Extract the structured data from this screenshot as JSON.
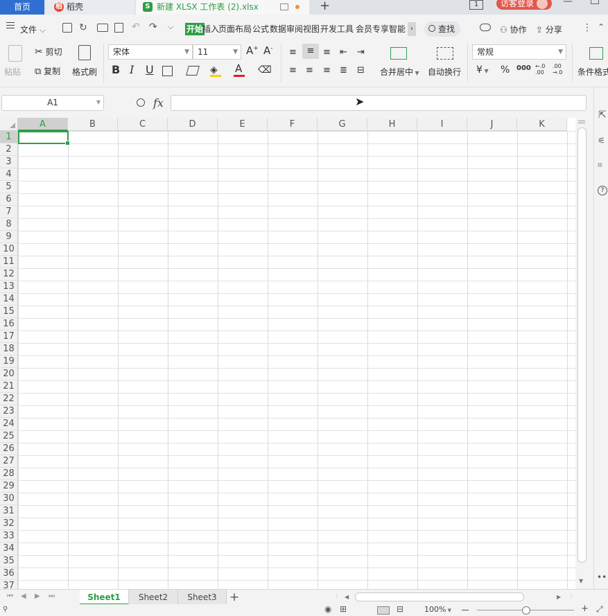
{
  "tabs": {
    "home": "首页",
    "daoke": "稻壳",
    "doc": "新建 XLSX 工作表 (2).xlsx",
    "new_tab": "+",
    "page_count": "1",
    "login": "访客登录"
  },
  "menu": {
    "file": "文件",
    "items": [
      "开始",
      "插入",
      "页面布局",
      "公式",
      "数据",
      "审阅",
      "视图",
      "开发工具",
      "会员专享",
      "智能"
    ],
    "search": "查找",
    "collab": "协作",
    "share": "分享"
  },
  "ribbon": {
    "paste": "粘贴",
    "cut": "剪切",
    "copy": "复制",
    "format_painter": "格式刷",
    "font_name": "宋体",
    "font_size": "11",
    "merge_center": "合并居中",
    "wrap_text": "自动换行",
    "number_format": "常规",
    "cond_format": "条件格式",
    "currency": "¥",
    "percent": "%",
    "thousands": "000",
    "inc_dec": "+.0\n.00",
    "dec_dec": ".00\n→.0"
  },
  "formula": {
    "name_box": "A1",
    "fx": "fx",
    "value": ""
  },
  "grid": {
    "columns": [
      "A",
      "B",
      "C",
      "D",
      "E",
      "F",
      "G",
      "H",
      "I",
      "J",
      "K"
    ],
    "rows": [
      "1",
      "2",
      "3",
      "4",
      "5",
      "6",
      "7",
      "8",
      "9",
      "10",
      "11",
      "12",
      "13",
      "14",
      "15",
      "16",
      "17",
      "18",
      "19",
      "20",
      "21",
      "22",
      "23",
      "24",
      "25",
      "26",
      "27",
      "28",
      "29",
      "30",
      "31",
      "32",
      "33",
      "34",
      "35",
      "36",
      "37"
    ],
    "active_cell": "A1"
  },
  "sheets": {
    "tabs": [
      "Sheet1",
      "Sheet2",
      "Sheet3"
    ],
    "active": "Sheet1",
    "add": "+"
  },
  "status": {
    "zoom": "100%"
  },
  "colors": {
    "accent_green": "#2e9e47",
    "home_tab_blue": "#2f6fd1",
    "login_red": "#e4574b",
    "active_header": "#d0d0d0"
  }
}
